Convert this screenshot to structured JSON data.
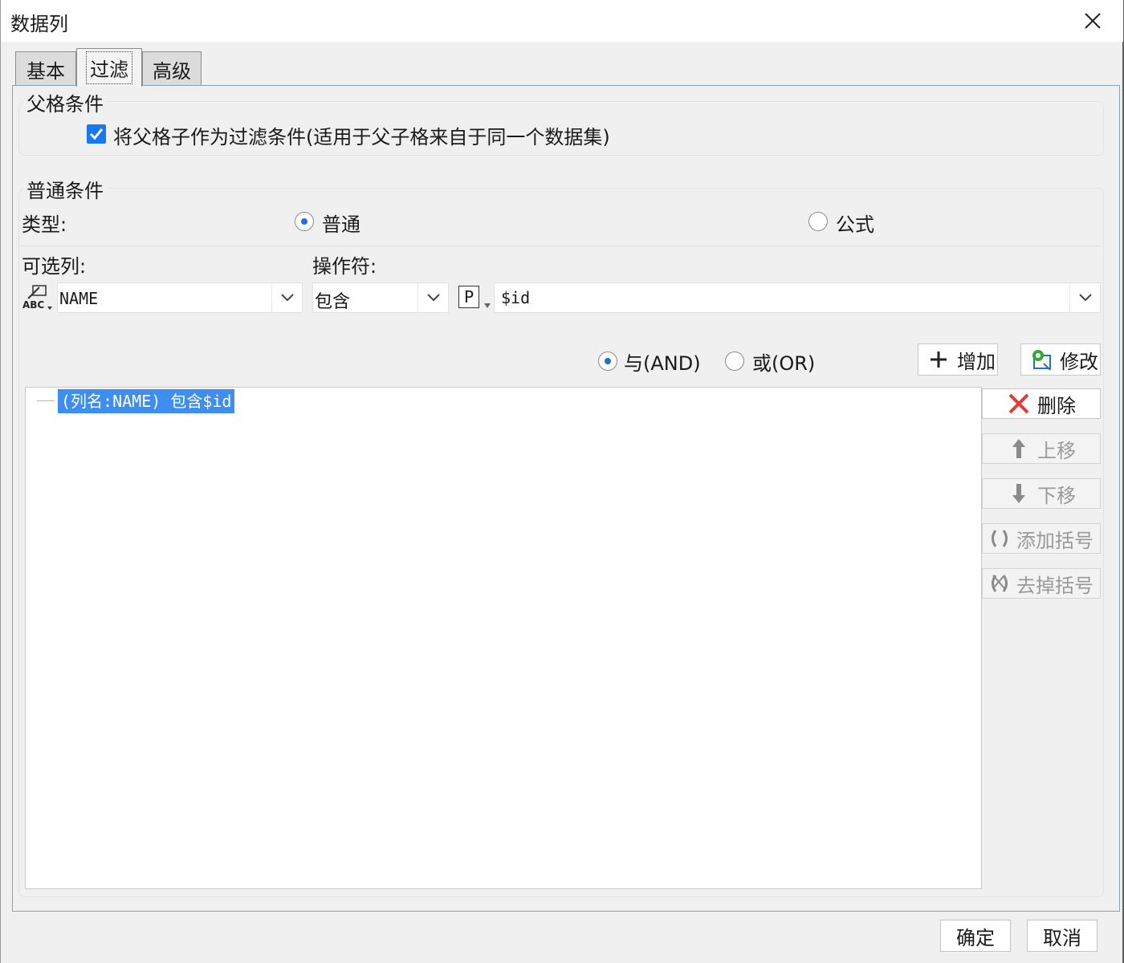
{
  "window": {
    "title": "数据列"
  },
  "tabs": [
    {
      "label": "基本"
    },
    {
      "label": "过滤"
    },
    {
      "label": "高级"
    }
  ],
  "parent_condition": {
    "group_title": "父格条件",
    "checkbox_label": "将父格子作为过滤条件(适用于父子格来自于同一个数据集)",
    "checked": true
  },
  "normal_condition": {
    "group_title": "普通条件",
    "type_label": "类型:",
    "type_options": [
      "普通",
      "公式"
    ],
    "selected_type": "普通",
    "column_label": "可选列:",
    "operator_label": "操作符:",
    "column_value": "NAME",
    "operator_value": "包含",
    "param_badge": "P",
    "value_text": "$id"
  },
  "logic": {
    "and_label": "与(AND)",
    "or_label": "或(OR)",
    "selected": "AND"
  },
  "actions": {
    "add": "增加",
    "modify": "修改",
    "delete": "删除",
    "move_up": "上移",
    "move_down": "下移",
    "add_bracket": "添加括号",
    "remove_bracket": "去掉括号"
  },
  "conditions": [
    {
      "text": "(列名:NAME) 包含$id"
    }
  ],
  "footer": {
    "ok": "确定",
    "cancel": "取消"
  },
  "colors": {
    "accent": "#1877f2",
    "selection": "#3d8ef0",
    "delete_red": "#e53935",
    "modify_green": "#3aa63a"
  }
}
